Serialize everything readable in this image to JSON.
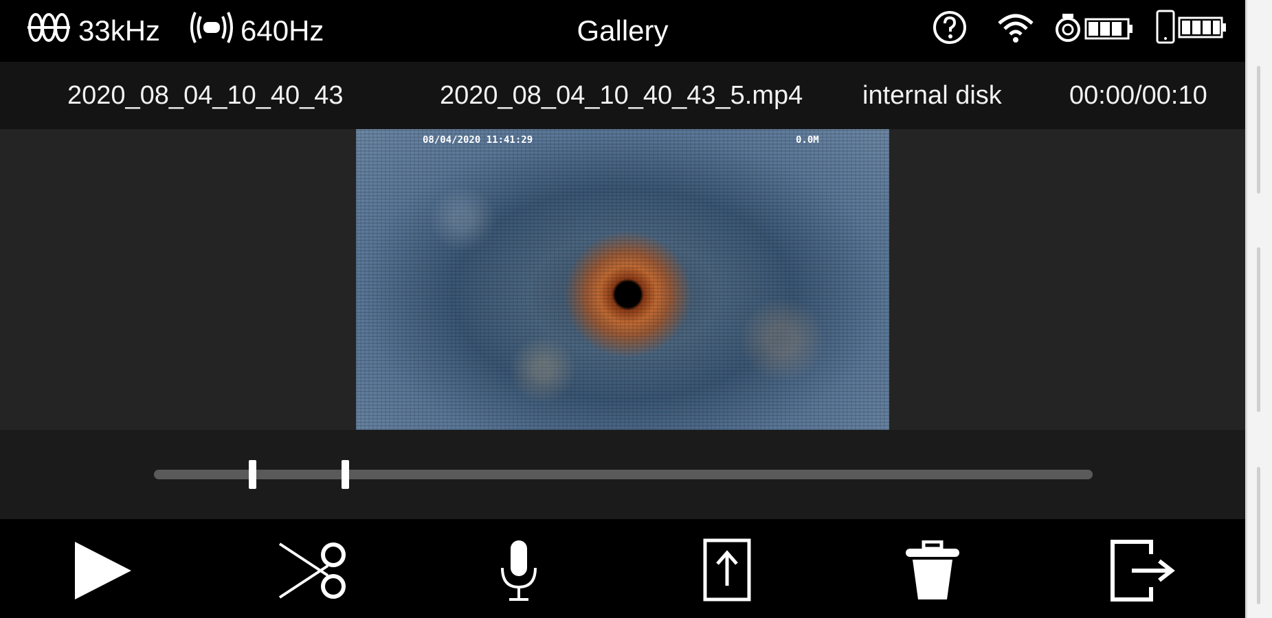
{
  "status_bar": {
    "transmitter_freq": "33kHz",
    "sonde_freq": "640Hz",
    "title": "Gallery",
    "icons": [
      "transmitter-coil-icon",
      "sonde-icon",
      "help-icon",
      "wifi-icon",
      "camera-battery-icon",
      "phone-battery-icon"
    ]
  },
  "file_info": {
    "folder": "2020_08_04_10_40_43",
    "filename": "2020_08_04_10_40_43_5.mp4",
    "storage": "internal disk",
    "time": "00:00/00:10"
  },
  "video": {
    "osd_date": "08/04/2020  11:41:29",
    "osd_distance": "0.0M"
  },
  "scrub": {
    "progress": 0.0
  },
  "toolbar": {
    "buttons": [
      "play-icon",
      "scissors-icon",
      "microphone-icon",
      "export-icon",
      "trash-icon",
      "exit-icon"
    ]
  },
  "colors": {
    "background": "#000000",
    "info_row": "#141414",
    "video_area": "#242424",
    "track": "#5a5a5a",
    "foreground": "#ffffff"
  }
}
